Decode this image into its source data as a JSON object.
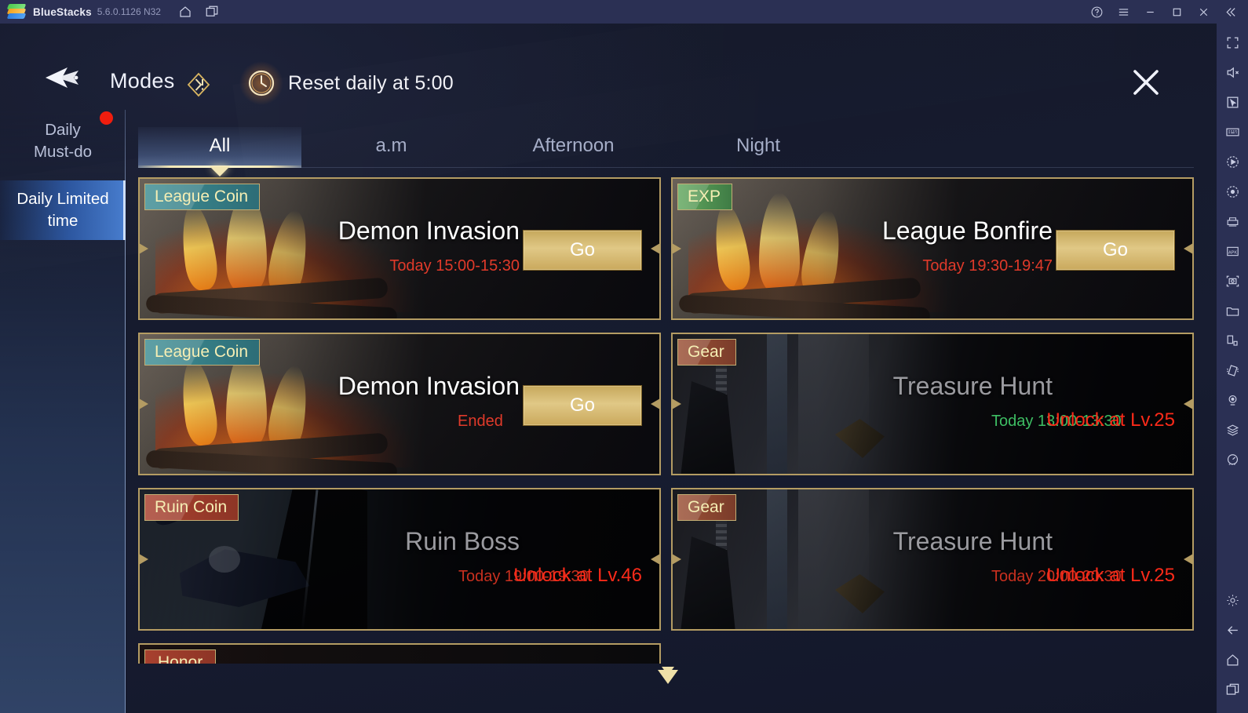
{
  "titlebar": {
    "app_name": "BlueStacks",
    "version": "5.6.0.1126 N32",
    "icons": [
      "home-icon",
      "multi-instance-icon"
    ],
    "window_controls": [
      "help-icon",
      "menu-icon",
      "minimize-icon",
      "maximize-icon",
      "close-icon",
      "collapse-icon"
    ]
  },
  "right_sidebar": {
    "items": [
      "fullscreen-icon",
      "mute-icon",
      "cursor-icon",
      "keyboard-icon",
      "macro-play-icon",
      "record-icon",
      "multi-instance-manager-icon",
      "install-apk-icon",
      "screenshot-icon",
      "media-folder-icon",
      "rotate-icon",
      "shake-icon",
      "location-icon",
      "layers-icon",
      "performance-icon"
    ],
    "bottom_items": [
      "settings-gear-icon",
      "back-icon",
      "home-icon",
      "recents-icon"
    ]
  },
  "header": {
    "back_label": "back-arrow-icon",
    "title": "Modes",
    "info_icon": "info-diamond-icon",
    "clock_icon": "clock-icon",
    "reset_text": "Reset daily at 5:00",
    "close_label": "close-icon"
  },
  "sidebar": {
    "items": [
      {
        "label_line1": "Daily",
        "label_line2": "Must-do",
        "selected": false,
        "has_dot": true
      },
      {
        "label_line1": "Daily Limited",
        "label_line2": "time",
        "selected": true,
        "has_dot": false
      }
    ]
  },
  "tabs": [
    {
      "label": "All",
      "active": true
    },
    {
      "label": "a.m",
      "active": false
    },
    {
      "label": "Afternoon",
      "active": false
    },
    {
      "label": "Night",
      "active": false
    }
  ],
  "cards": [
    {
      "badge": "League Coin",
      "badge_color": "teal",
      "title": "Demon Invasion",
      "time": "Today 15:00-15:30",
      "time_color": "#e03a2a",
      "action": "Go",
      "locked": false,
      "art": "bonfire"
    },
    {
      "badge": "EXP",
      "badge_color": "green",
      "title": "League Bonfire",
      "time": "Today 19:30-19:47",
      "time_color": "#e03a2a",
      "action": "Go",
      "locked": false,
      "art": "bonfire"
    },
    {
      "badge": "League Coin",
      "badge_color": "teal",
      "title": "Demon Invasion",
      "time": "Ended",
      "time_color": "#e03a2a",
      "action": "Go",
      "locked": false,
      "art": "bonfire"
    },
    {
      "badge": "Gear",
      "badge_color": "brown",
      "title": "Treasure Hunt",
      "time": "Today 13:00-13:30",
      "time_color": "#3dbd63",
      "lock_message": "Unlock at Lv.25",
      "locked": true,
      "art": "ruins"
    },
    {
      "badge": "Ruin Coin",
      "badge_color": "red",
      "title": "Ruin Boss",
      "time": "Today 19:00-19:30",
      "time_color": "#c9301f",
      "lock_message": "Unlock at Lv.46",
      "locked": true,
      "art": "boss"
    },
    {
      "badge": "Gear",
      "badge_color": "brown",
      "title": "Treasure Hunt",
      "time": "Today 20:00-20:30",
      "time_color": "#c9301f",
      "lock_message": "Unlock at Lv.25",
      "locked": true,
      "art": "ruins"
    }
  ],
  "partial_card": {
    "badge": "Honor",
    "badge_color": "red"
  },
  "scroll_indicator": "scroll-down-caret",
  "colors": {
    "accent_gold": "#e0c886",
    "frame_gold": "#b49c63",
    "danger_red": "#fb2a19",
    "ok_green": "#3dbd63",
    "selected_blue": "#3060b2"
  }
}
